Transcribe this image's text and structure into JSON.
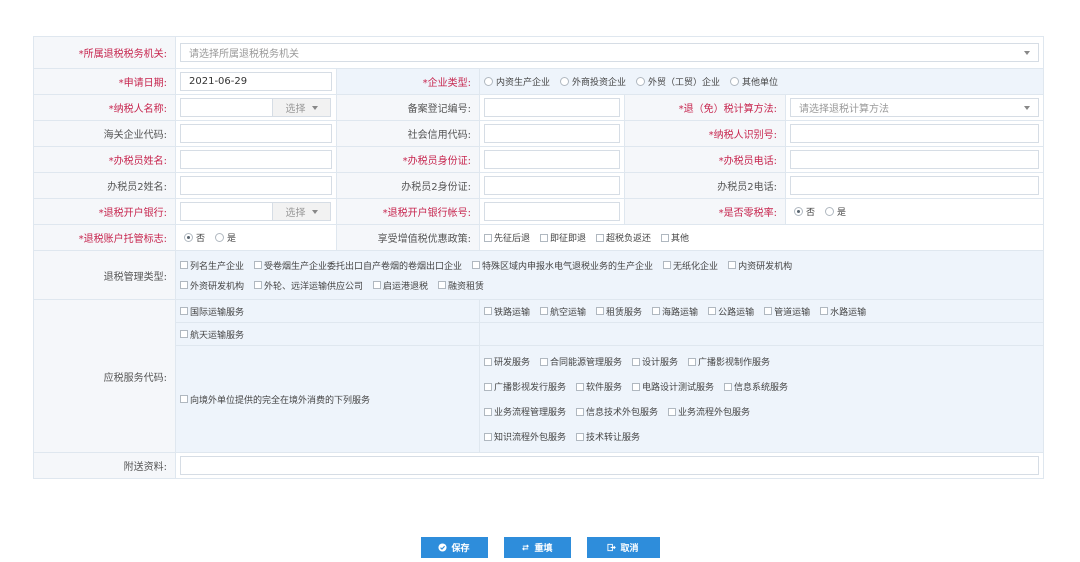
{
  "rows": {
    "tax_authority": {
      "label": "*所属退税税务机关:",
      "placeholder": "请选择所属退税税务机关"
    },
    "apply_date": {
      "label": "*申请日期:",
      "value": "2021-06-29"
    },
    "enterprise_type": {
      "label": "*企业类型:",
      "options": [
        "内资生产企业",
        "外商投资企业",
        "外贸（工贸）企业",
        "其他单位"
      ]
    },
    "taxpayer_name": {
      "label": "*纳税人名称:",
      "pick_label": "选择"
    },
    "filing_no": {
      "label": "备案登记编号:"
    },
    "calc_method": {
      "label": "*退（免）税计算方法:",
      "placeholder": "请选择退税计算方法"
    },
    "customs_code": {
      "label": "海关企业代码:"
    },
    "credit_code": {
      "label": "社会信用代码:"
    },
    "taxpayer_id": {
      "label": "*纳税人识别号:"
    },
    "agent_name": {
      "label": "*办税员姓名:"
    },
    "agent_id": {
      "label": "*办税员身份证:"
    },
    "agent_phone": {
      "label": "*办税员电话:"
    },
    "agent2_name": {
      "label": "办税员2姓名:"
    },
    "agent2_id": {
      "label": "办税员2身份证:"
    },
    "agent2_phone": {
      "label": "办税员2电话:"
    },
    "bank": {
      "label": "*退税开户银行:",
      "pick_label": "选择"
    },
    "bank_account": {
      "label": "*退税开户银行帐号:"
    },
    "zero_rate": {
      "label": "*是否零税率:",
      "options": [
        "否",
        "是"
      ],
      "selected": "否"
    },
    "trust_flag": {
      "label": "*退税账户托管标志:",
      "options": [
        "否",
        "是"
      ],
      "selected": "否"
    },
    "vat_policy": {
      "label": "享受增值税优惠政策:",
      "options": [
        "先征后退",
        "即征即退",
        "超税负返还",
        "其他"
      ]
    },
    "mgmt_type": {
      "label": "退税管理类型:",
      "options": [
        "列名生产企业",
        "受卷烟生产企业委托出口自产卷烟的卷烟出口企业",
        "特殊区域内申报水电气退税业务的生产企业",
        "无纸化企业",
        "内资研发机构",
        "外资研发机构",
        "外轮、远洋运输供应公司",
        "启运港退税",
        "融资租赁"
      ]
    },
    "service_code": {
      "label": "应税服务代码:",
      "left": {
        "intl": "国际运输服务",
        "space": "航天运输服务",
        "overseas": "向境外单位提供的完全在境外消费的下列服务"
      },
      "transport": [
        "铁路运输",
        "航空运输",
        "租赁服务",
        "海路运输",
        "公路运输",
        "管道运输",
        "水路运输"
      ],
      "services": [
        [
          "研发服务",
          "合同能源管理服务",
          "设计服务",
          "广播影视制作服务"
        ],
        [
          "广播影视发行服务",
          "软件服务",
          "电路设计测试服务",
          "信息系统服务"
        ],
        [
          "业务流程管理服务",
          "信息技术外包服务",
          "业务流程外包服务"
        ],
        [
          "知识流程外包服务",
          "技术转让服务"
        ]
      ]
    },
    "attachments": {
      "label": "附送资料:"
    }
  },
  "buttons": {
    "save": "保存",
    "reset": "重填",
    "cancel": "取消"
  }
}
